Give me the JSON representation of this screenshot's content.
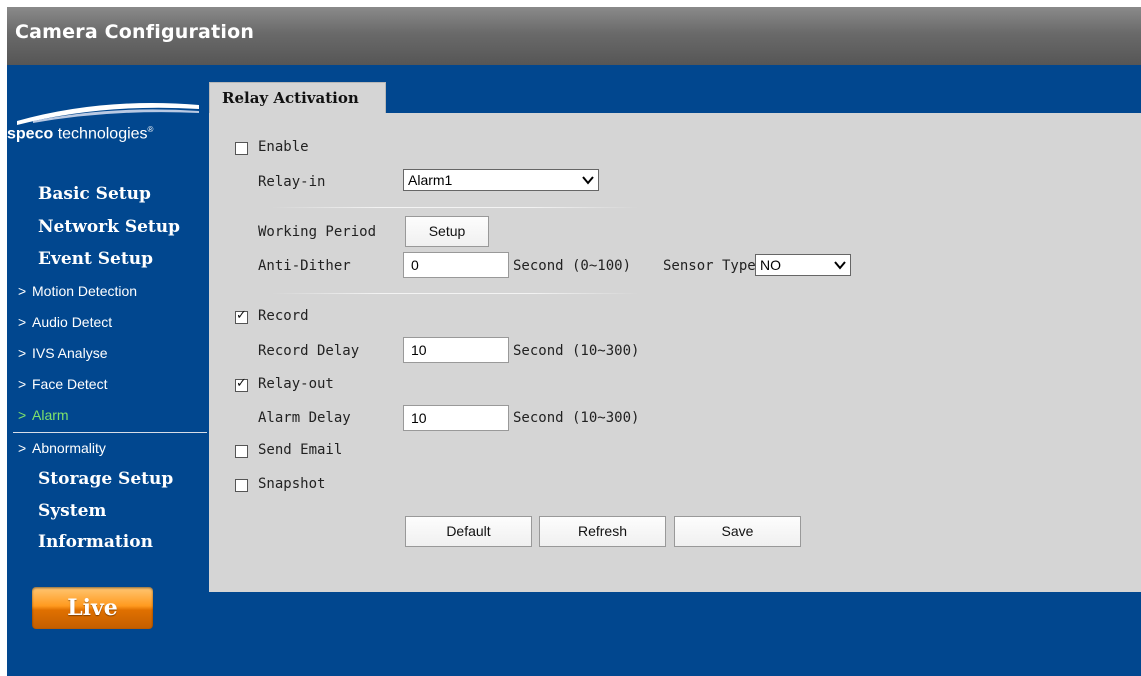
{
  "app": {
    "title": "Camera Configuration"
  },
  "logo": {
    "brand_bold": "speco",
    "brand_rest": " technologies",
    "mark": "®"
  },
  "sidebar": {
    "basic_setup": "Basic Setup",
    "network_setup": "Network Setup",
    "event_setup": "Event Setup",
    "sub_items": [
      "Motion Detection",
      "Audio Detect",
      "IVS Analyse",
      "Face Detect",
      "Alarm",
      "Abnormality"
    ],
    "chevron": ">",
    "storage_setup": "Storage Setup",
    "system": "System",
    "information": "Information",
    "live": "Live"
  },
  "tab": {
    "label": "Relay Activation"
  },
  "form": {
    "enable": {
      "label": "Enable",
      "checked": false
    },
    "relay_in": {
      "label": "Relay-in",
      "value": "Alarm1"
    },
    "working_period": {
      "label": "Working Period",
      "button": "Setup"
    },
    "anti_dither": {
      "label": "Anti-Dither",
      "value": "0",
      "unit": "Second (0~100)"
    },
    "sensor_type": {
      "label": "Sensor Type",
      "value": "NO"
    },
    "record": {
      "label": "Record",
      "checked": true
    },
    "record_delay": {
      "label": "Record Delay",
      "value": "10",
      "unit": "Second (10~300)"
    },
    "relay_out": {
      "label": "Relay-out",
      "checked": true
    },
    "alarm_delay": {
      "label": "Alarm Delay",
      "value": "10",
      "unit": "Second (10~300)"
    },
    "send_email": {
      "label": "Send Email",
      "checked": false
    },
    "snapshot": {
      "label": "Snapshot",
      "checked": false
    }
  },
  "buttons": {
    "default": "Default",
    "refresh": "Refresh",
    "save": "Save"
  },
  "colors": {
    "background": "#01478f",
    "panel": "#d5d5d5",
    "active_nav": "#7fe36a",
    "live_button": "#ff9a1f"
  }
}
